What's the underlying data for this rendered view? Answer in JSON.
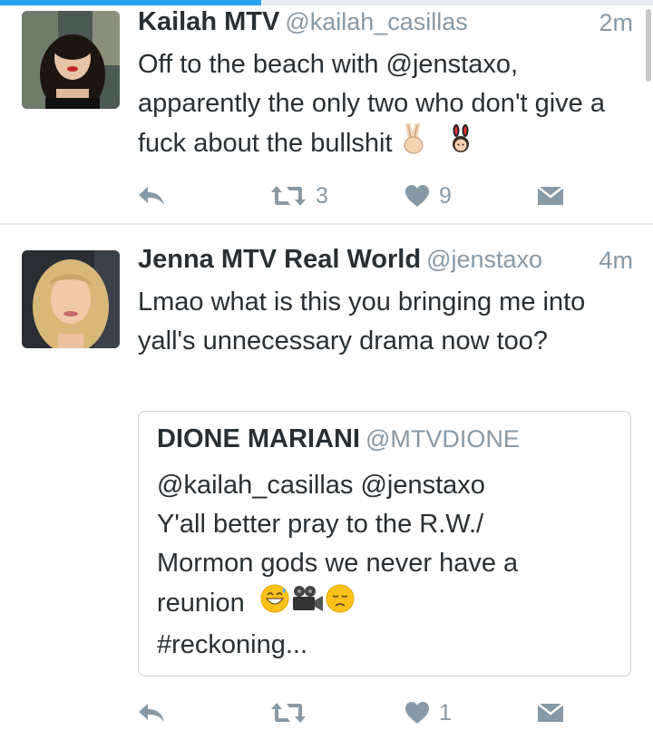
{
  "progress": {
    "fraction": 0.4
  },
  "tweets": [
    {
      "display_name": "Kailah MTV",
      "handle": "@kailah_casillas",
      "time": "2m",
      "text": "Off to the beach with @jenstaxo, apparently the only two who don't give a fuck about the bullshit",
      "emojis": [
        "victory-hand-emoji",
        "bunny-girl-emoji"
      ],
      "retweet_count": "3",
      "like_count": "9"
    },
    {
      "display_name": "Jenna MTV Real World",
      "handle": "@jenstaxo",
      "time": "4m",
      "text": "Lmao what is this you bringing me into yall's unnecessary drama now too?",
      "retweet_count": "",
      "like_count": "1",
      "quote": {
        "display_name": "DIONE MARIANI",
        "handle": "@MTVDIONE",
        "line1": "@kailah_casillas @jenstaxo",
        "line2": "Y'all better pray to the R.W./",
        "line3": "Mormon gods we never have a",
        "line4": "reunion",
        "line5": "#reckoning...",
        "emojis": [
          "grinning-sweat-emoji",
          "movie-camera-emoji",
          "disappointed-face-emoji"
        ]
      }
    }
  ],
  "colors": {
    "accent": "#2aa3ef",
    "muted": "#8899a6",
    "text": "#292f33",
    "divider": "#e1e8ed"
  },
  "icons": [
    "reply-icon",
    "retweet-icon",
    "like-icon",
    "direct-message-icon"
  ]
}
